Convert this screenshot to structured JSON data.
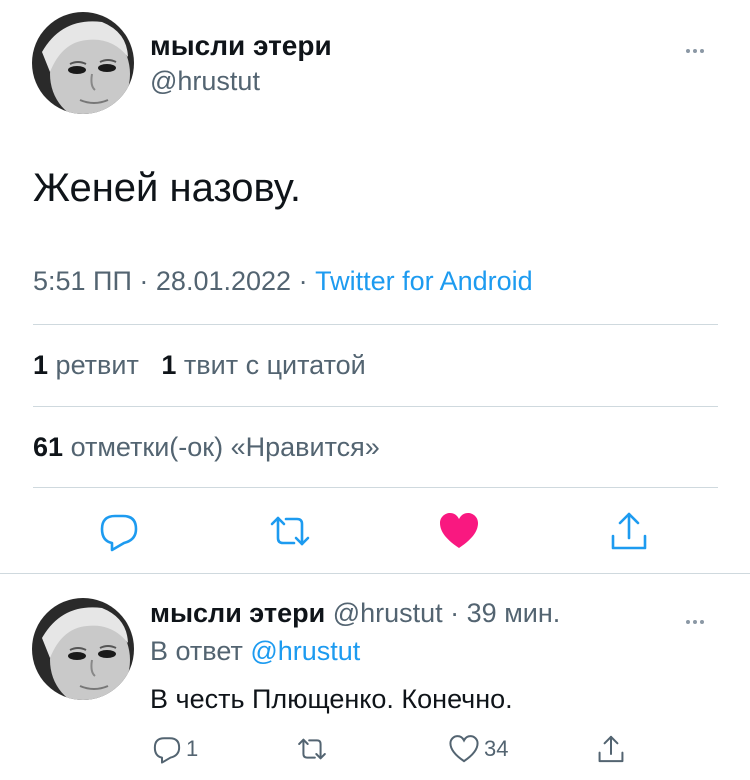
{
  "tweet": {
    "author_name": "мысли этери",
    "author_handle": "@hrustut",
    "text": "Женей назову.",
    "time": "5:51 ПП",
    "separator": "·",
    "date": "28.01.2022",
    "source": "Twitter for Android",
    "retweets_count": "1",
    "retweets_label": "ретвит",
    "quotes_count": "1",
    "quotes_label": "твит с цитатой",
    "likes_count": "61",
    "likes_label": "отметки(-ок) «Нравится»",
    "liked": true,
    "icons": [
      "more-icon",
      "reply-icon",
      "retweet-icon",
      "heart-filled-icon",
      "share-icon"
    ]
  },
  "reply": {
    "author_name": "мысли этери",
    "author_handle": "@hrustut",
    "time_ago": "39 мин.",
    "replying_prefix": "В ответ",
    "replying_to": "@hrustut",
    "text": "В честь Плющенко. Конечно.",
    "reply_count": "1",
    "retweet_count": "",
    "like_count": "34",
    "icons": [
      "more-icon",
      "reply-icon",
      "retweet-icon",
      "heart-outline-icon",
      "share-icon"
    ]
  },
  "colors": {
    "accent": "#1d9bf0",
    "like": "#f91880",
    "secondary_text": "#536471",
    "divider": "#cfd9de"
  }
}
